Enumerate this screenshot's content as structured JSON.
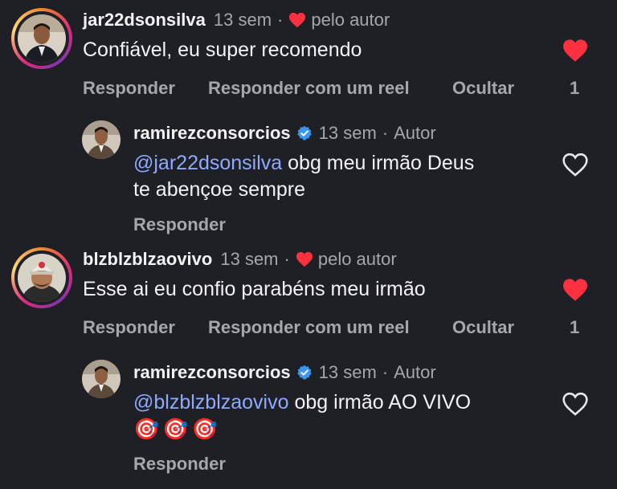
{
  "comments": [
    {
      "username": "jar22dsonsilva",
      "time": "13 sem",
      "liked_by_author": "pelo autor",
      "text": "Confiável, eu super recomendo",
      "actions": {
        "reply": "Responder",
        "reply_reel": "Responder com um reel",
        "hide": "Ocultar"
      },
      "likes": "1",
      "reply": {
        "username": "ramirezconsorcios",
        "time": "13 sem",
        "badge": "Autor",
        "mention": "@jar22dsonsilva",
        "text_line1": " obg meu irmão Deus",
        "text_line2": "te abençoe sempre",
        "reply_label": "Responder"
      }
    },
    {
      "username": "blzblzblzaovivo",
      "time": "13 sem",
      "liked_by_author": "pelo autor",
      "text": "Esse ai eu confio parabéns meu irmão",
      "actions": {
        "reply": "Responder",
        "reply_reel": "Responder com um reel",
        "hide": "Ocultar"
      },
      "likes": "1",
      "reply": {
        "username": "ramirezconsorcios",
        "time": "13 sem",
        "badge": "Autor",
        "mention": "@blzblzblzaovivo",
        "text_line1": " obg irmão AO VIVO",
        "emojis": "🎯🎯🎯",
        "reply_label": "Responder"
      }
    }
  ],
  "colors": {
    "background": "#1f1f26",
    "like_red": "#ff3040",
    "mention": "#8fa9ff",
    "verified": "#3897f0",
    "muted": "#a6a7ad"
  },
  "icons": {
    "like_filled": "heart-filled-icon",
    "like_outline": "heart-outline-icon",
    "verified": "verified-badge-icon"
  }
}
